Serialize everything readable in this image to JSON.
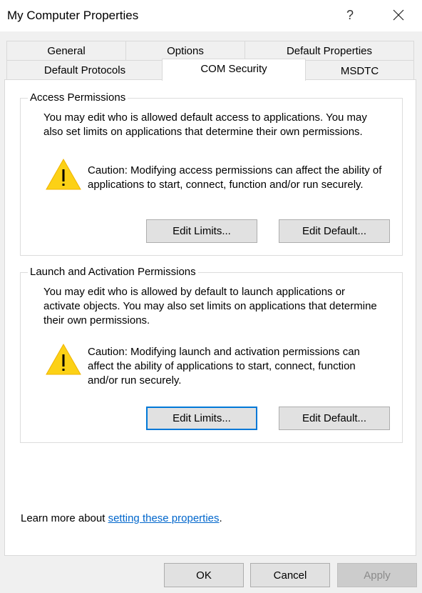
{
  "window": {
    "title": "My Computer Properties",
    "help_glyph": "?",
    "close_icon": "close-icon"
  },
  "tabs": {
    "row1": [
      {
        "label": "General"
      },
      {
        "label": "Options"
      },
      {
        "label": "Default Properties"
      }
    ],
    "row2": [
      {
        "label": "Default Protocols"
      },
      {
        "label": "COM Security",
        "selected": true
      },
      {
        "label": "MSDTC"
      }
    ]
  },
  "access": {
    "label": "Access Permissions",
    "description": "You may edit who is allowed default access to applications. You may also set limits on applications that determine their own permissions.",
    "caution": "Caution: Modifying access permissions can affect the ability of applications to start, connect, function and/or run securely.",
    "icon": "warning-icon",
    "edit_limits": "Edit Limits...",
    "edit_default": "Edit Default..."
  },
  "launch": {
    "label": "Launch and Activation Permissions",
    "description": "You may edit who is allowed by default to launch applications or activate objects. You may also set limits on applications that determine their own permissions.",
    "caution": "Caution: Modifying launch and activation permissions can affect the ability of applications to start, connect, function and/or run securely.",
    "icon": "warning-icon",
    "edit_limits": "Edit Limits...",
    "edit_default": "Edit Default..."
  },
  "learn_more": {
    "prefix": "Learn more about ",
    "link": "setting these properties",
    "suffix": "."
  },
  "footer": {
    "ok": "OK",
    "cancel": "Cancel",
    "apply": "Apply",
    "apply_disabled": true
  },
  "colors": {
    "link": "#0066cc",
    "focus": "#0078d7",
    "warning": "#fcd116"
  }
}
